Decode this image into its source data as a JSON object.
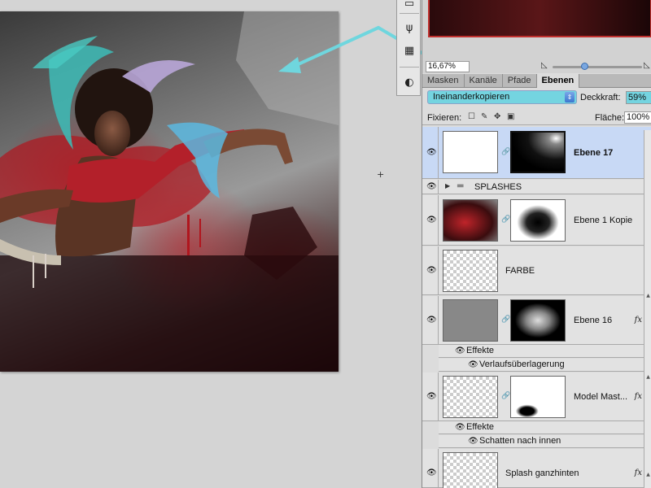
{
  "navigator": {
    "zoom_value": "16,67%",
    "zoom_slider_level": 0.35
  },
  "tabs": [
    {
      "label": "Masken",
      "active": false
    },
    {
      "label": "Kanäle",
      "active": false
    },
    {
      "label": "Pfade",
      "active": false
    },
    {
      "label": "Ebenen",
      "active": true
    }
  ],
  "blend": {
    "mode": "Ineinanderkopieren",
    "opacity_label": "Deckkraft:",
    "opacity_value": "59%"
  },
  "lock": {
    "label": "Fixieren:",
    "fill_label": "Fläche:",
    "fill_value": "100%"
  },
  "layers": [
    {
      "name": "Ebene 17",
      "selected": true,
      "fx": false
    },
    {
      "name": "SPLASHES",
      "type": "group"
    },
    {
      "name": "Ebene 1 Kopie",
      "fx": false
    },
    {
      "name": "FARBE",
      "fx": false
    },
    {
      "name": "Ebene 16",
      "fx": true,
      "fx_label": "fx",
      "effects_label": "Effekte",
      "effect": "Verlaufsüberlagerung"
    },
    {
      "name": "Model Mast...",
      "fx": true,
      "fx_label": "fx",
      "effects_label": "Effekte",
      "effect": "Schatten nach innen"
    },
    {
      "name": "Splash ganzhinten",
      "fx": true,
      "fx_label": "fx"
    }
  ],
  "icons": {
    "eye": "eye-icon",
    "chain": "chain-link-icon",
    "folder": "folder-icon",
    "triangle": "disclosure-triangle-icon"
  },
  "colors": {
    "arrow": "#6fd6de",
    "selection": "#c8d9f5",
    "blend_highlight": "#74d4e0"
  }
}
